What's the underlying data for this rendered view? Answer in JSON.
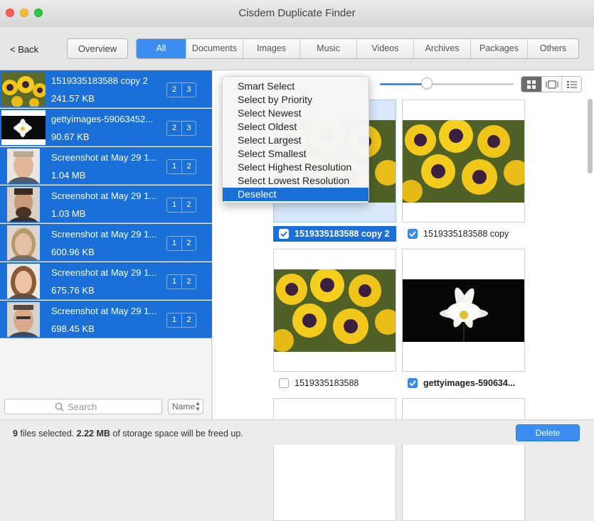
{
  "window": {
    "title": "Cisdem Duplicate Finder"
  },
  "toolbar": {
    "back_label": "< Back",
    "overview_label": "Overview",
    "tabs": [
      "All",
      "Documents",
      "Images",
      "Music",
      "Videos",
      "Archives",
      "Packages",
      "Others"
    ],
    "active_tab": "All"
  },
  "sidebar": {
    "groups": [
      {
        "name": "1519335183588 copy 2",
        "size": "241.57 KB",
        "badges": [
          "2",
          "3"
        ],
        "thumb": "pansy"
      },
      {
        "name": "gettyimages-59063452...",
        "size": "90.67 KB",
        "badges": [
          "2",
          "3"
        ],
        "thumb": "lotus"
      },
      {
        "name": "Screenshot at May 29 1...",
        "size": "1.04 MB",
        "badges": [
          "1",
          "2"
        ],
        "thumb": "face-1"
      },
      {
        "name": "Screenshot at May 29 1...",
        "size": "1.03 MB",
        "badges": [
          "1",
          "2"
        ],
        "thumb": "face-2"
      },
      {
        "name": "Screenshot at May 29 1...",
        "size": "600.96 KB",
        "badges": [
          "1",
          "2"
        ],
        "thumb": "face-3"
      },
      {
        "name": "Screenshot at May 29 1...",
        "size": "675.76 KB",
        "badges": [
          "1",
          "2"
        ],
        "thumb": "face-4"
      },
      {
        "name": "Screenshot at May 29 1...",
        "size": "698.45 KB",
        "badges": [
          "1",
          "2"
        ],
        "thumb": "face-5"
      }
    ],
    "search_placeholder": "Search",
    "sort_label": "Name"
  },
  "grid": {
    "zoom": 0.35,
    "view_modes": [
      "grid-view-icon",
      "filmstrip-view-icon",
      "list-view-icon"
    ],
    "items": [
      {
        "name": "1519335183588 copy 2",
        "checked": true,
        "highlighted": true,
        "image": "pansy"
      },
      {
        "name": "1519335183588 copy",
        "checked": true,
        "highlighted": false,
        "image": "pansy"
      },
      {
        "name": "1519335183588",
        "checked": false,
        "highlighted": false,
        "image": "pansy"
      },
      {
        "name": "gettyimages-590634...",
        "checked": true,
        "highlighted": false,
        "image": "lotus"
      }
    ]
  },
  "select_menu": {
    "items": [
      "Smart Select",
      "Select by Priority",
      "Select Newest",
      "Select Oldest",
      "Select Largest",
      "Select Smallest",
      "Select Highest Resolution",
      "Select Lowest Resolution",
      "Deselect"
    ],
    "highlighted": "Deselect"
  },
  "status": {
    "count": "9",
    "text1": " files selected. ",
    "size": "2.22 MB",
    "text2": " of storage space will be freed up."
  },
  "actions": {
    "delete_label": "Delete"
  },
  "colors": {
    "accent": "#1a6fd8",
    "button_blue": "#3b8ef0"
  }
}
